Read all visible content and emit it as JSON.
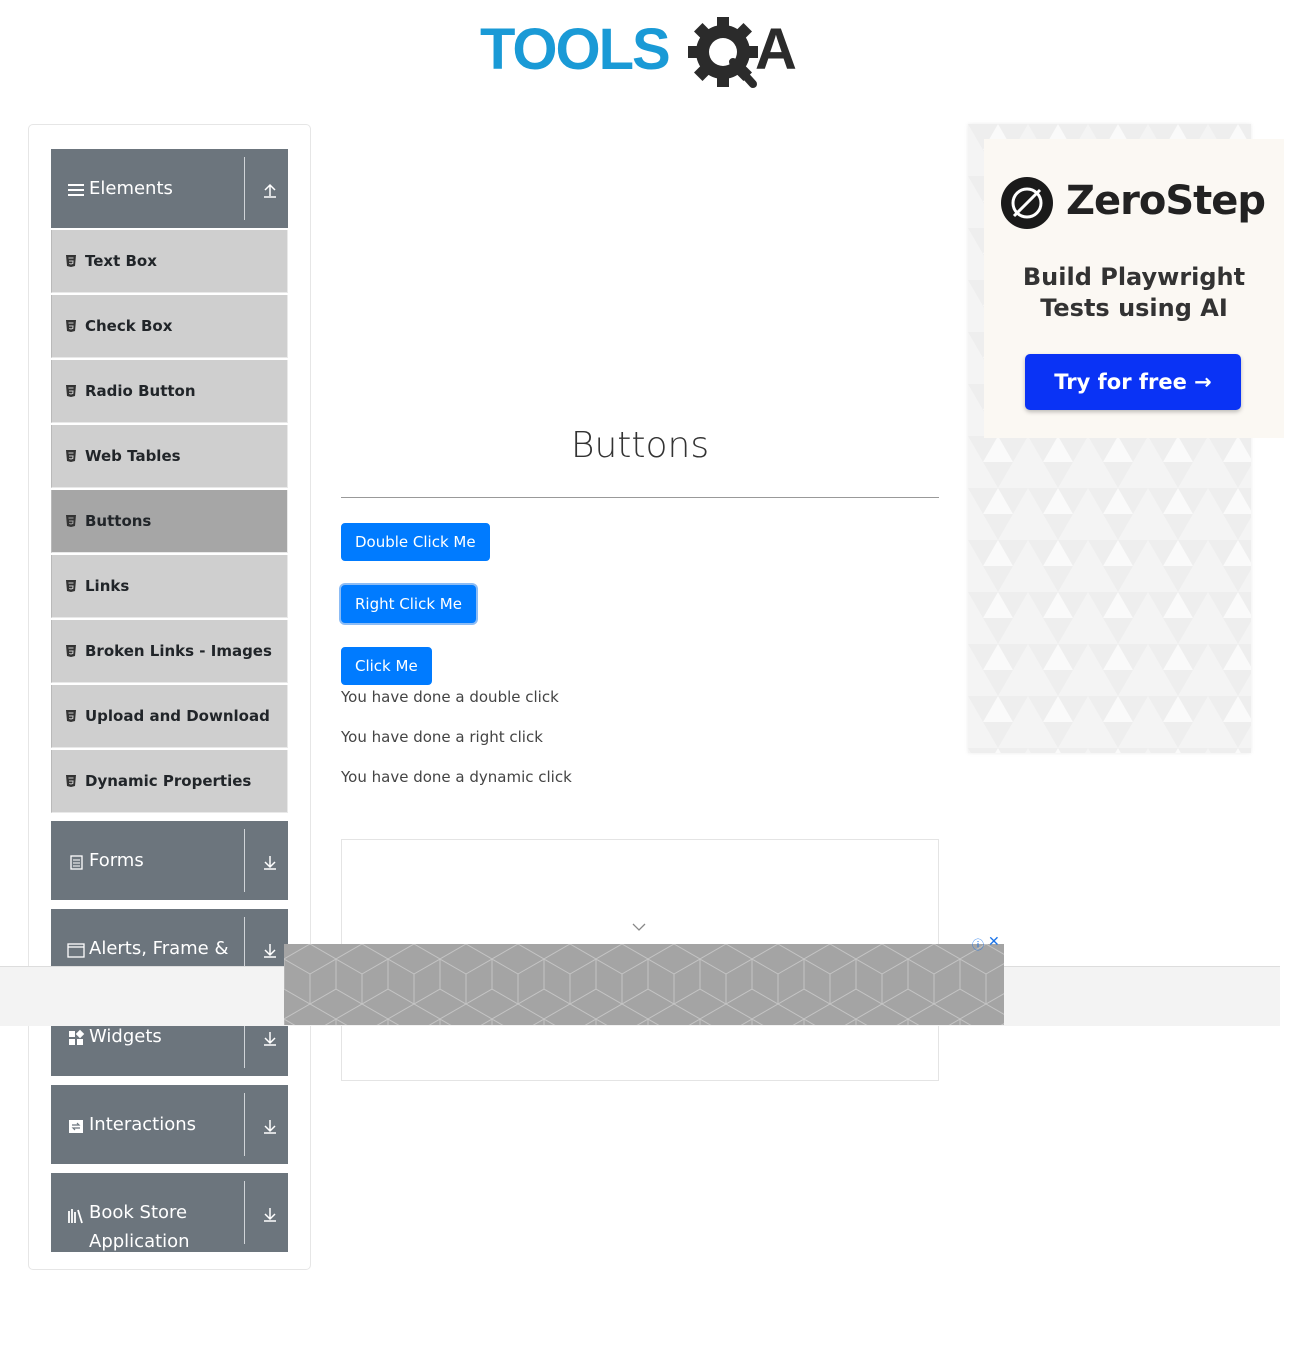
{
  "header": {
    "logo_text_left": "TOOLS",
    "logo_text_right": "QA",
    "colors": {
      "logo_blue": "#1a9ad6",
      "logo_dark": "#2b2b2b"
    }
  },
  "sidebar": {
    "groups": [
      {
        "label": "Elements",
        "icon": "hamburger-icon",
        "arrow": "collapse-up-icon"
      },
      {
        "label": "Forms",
        "icon": "form-icon",
        "arrow": "expand-down-icon"
      },
      {
        "label": "Alerts, Frame &",
        "icon": "window-icon",
        "arrow": "expand-down-icon"
      },
      {
        "label": "Widgets",
        "icon": "widgets-icon",
        "arrow": "expand-down-icon"
      },
      {
        "label": "Interactions",
        "icon": "interactions-icon",
        "arrow": "expand-down-icon"
      },
      {
        "label": "Book Store Application",
        "label_line1": "Book Store",
        "label_line2": "Application",
        "icon": "books-icon",
        "arrow": "expand-down-icon"
      }
    ],
    "elements_items": [
      {
        "label": "Text Box",
        "active": false
      },
      {
        "label": "Check Box",
        "active": false
      },
      {
        "label": "Radio Button",
        "active": false
      },
      {
        "label": "Web Tables",
        "active": false
      },
      {
        "label": "Buttons",
        "active": true
      },
      {
        "label": "Links",
        "active": false
      },
      {
        "label": "Broken Links - Images",
        "active": false
      },
      {
        "label": "Upload and Download",
        "active": false
      },
      {
        "label": "Dynamic Properties",
        "active": false
      }
    ],
    "colors": {
      "group_bg": "#6c757d",
      "item_bg": "#cfcfcf",
      "item_active_bg": "#a6a6a6"
    }
  },
  "main": {
    "title": "Buttons",
    "buttons": [
      {
        "label": "Double Click Me"
      },
      {
        "label": "Right Click Me"
      },
      {
        "label": "Click Me"
      }
    ],
    "messages": [
      "You have done a double click",
      "You have done a right click",
      "You have done a dynamic click"
    ],
    "colors": {
      "button_bg": "#007bff"
    }
  },
  "right_ad": {
    "brand": "ZeroStep",
    "tagline_line1": "Build Playwright",
    "tagline_line2": "Tests using AI",
    "cta": "Try for free →",
    "colors": {
      "cta_bg": "#0a33f5"
    }
  },
  "bottom_ad": {
    "info_glyph": "ⓘ",
    "close_glyph": "✕"
  }
}
